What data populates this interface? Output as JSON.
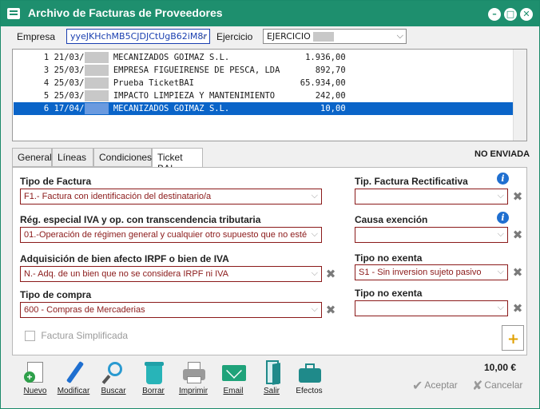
{
  "window": {
    "title": "Archivo de Facturas de Proveedores",
    "buttons": [
      "–",
      "□",
      "✕"
    ]
  },
  "header": {
    "empresa_label": "Empresa",
    "empresa_value": "yyeJKHchMB5CJDJCtUgB62iM8r",
    "ejercicio_label": "Ejercicio",
    "ejercicio_value": "EJERCICIO"
  },
  "invoice_list": {
    "rows": [
      {
        "num": "1",
        "date": "21/03/",
        "supplier": "MECANIZADOS GOIMAZ S.L.",
        "amount": "1.936,00",
        "selected": false
      },
      {
        "num": "3",
        "date": "25/03/",
        "supplier": "EMPRESA FIGUEIRENSE DE PESCA, LDA",
        "amount": "892,70",
        "selected": false
      },
      {
        "num": "4",
        "date": "25/03/",
        "supplier": "Prueba TicketBAI",
        "amount": "65.934,00",
        "selected": false
      },
      {
        "num": "5",
        "date": "25/03/",
        "supplier": "IMPACTO LIMPIEZA Y MANTENIMIENTO",
        "amount": "242,00",
        "selected": false
      },
      {
        "num": "6",
        "date": "17/04/",
        "supplier": "MECANIZADOS GOIMAZ S.L.",
        "amount": "10,00",
        "selected": true
      }
    ]
  },
  "tabs": [
    {
      "label": "General",
      "active": false
    },
    {
      "label": "Líneas",
      "active": false
    },
    {
      "label": "Condiciones",
      "active": false
    },
    {
      "label": "Ticket BAI",
      "active": true
    }
  ],
  "status": "NO ENVIADA",
  "ticketbai": {
    "tipo_factura_label": "Tipo de Factura",
    "tipo_factura_value": "F1.- Factura con identificación del destinatario/a",
    "regimen_label": "Rég. especial IVA y op. con transcendencia tributaria",
    "regimen_value": "01.-Operación de régimen general y cualquier otro supuesto que no esté",
    "adquisicion_label": "Adquisición de bien afecto IRPF o bien de IVA",
    "adquisicion_value": "N.- Adq. de un bien que no se considera IRPF ni IVA",
    "tipo_compra_label": "Tipo de compra",
    "tipo_compra_value": "600 - Compras de Mercaderias",
    "tip_rect_label": "Tip. Factura Rectificativa",
    "tip_rect_value": "",
    "causa_label": "Causa exención",
    "causa_value": "",
    "no_exenta1_label": "Tipo no exenta",
    "no_exenta1_value": "S1 - Sin inversion sujeto pasivo",
    "no_exenta2_label": "Tipo no exenta",
    "no_exenta2_value": "",
    "simplificada_label": "Factura Simplificada"
  },
  "toolbar": {
    "nuevo": "Nuevo",
    "modificar": "Modificar",
    "buscar": "Buscar",
    "borrar": "Borrar",
    "imprimir": "Imprimir",
    "email": "Email",
    "salir": "Salir",
    "efectos": "Efectos"
  },
  "total": "10,00 €",
  "actions": {
    "aceptar": "Aceptar",
    "cancelar": "Cancelar"
  },
  "colors": {
    "titlebar": "#1e8f6e",
    "selection": "#0a64c8",
    "field_border": "#8b1a1a",
    "info": "#1f6fd0"
  }
}
